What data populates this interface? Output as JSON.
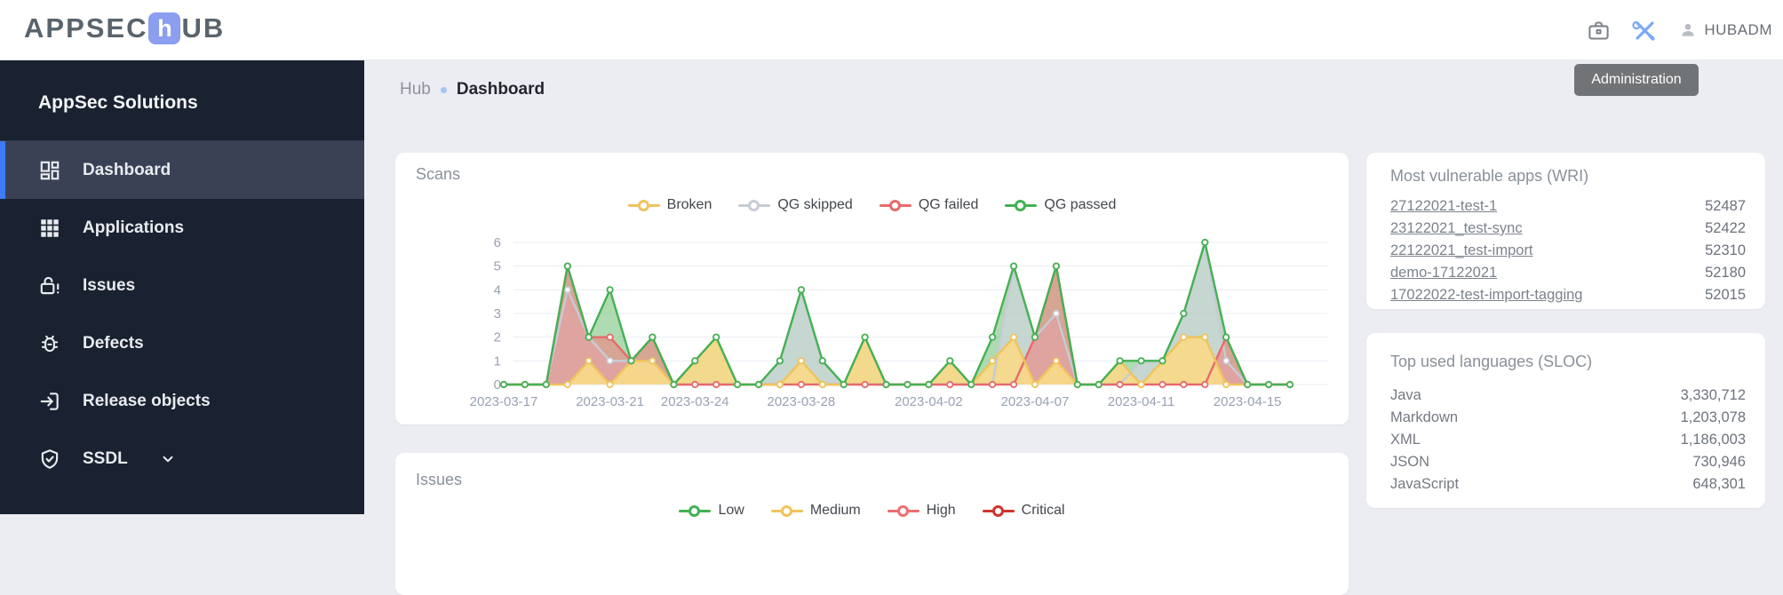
{
  "header": {
    "logo": {
      "prefix": "APPSEC",
      "accent_letter": "h",
      "suffix": "UB",
      "accent_color": "#8c9ef0",
      "text_color": "#5a646d"
    },
    "username": "HUBADM",
    "icons": {
      "briefcase": "briefcase-icon",
      "tools": "tools-icon",
      "user": "user-icon"
    },
    "tools_icon_color": "#7aa9f5"
  },
  "tooltip": {
    "text": "Administration",
    "bg": "#717476"
  },
  "sidebar": {
    "title": "AppSec Solutions",
    "bg": "#1a2130",
    "active_bg": "#3a4154",
    "accent": "#3d7bf7",
    "items": [
      {
        "label": "Dashboard",
        "icon": "dashboard-icon",
        "active": true
      },
      {
        "label": "Applications",
        "icon": "applications-icon",
        "active": false
      },
      {
        "label": "Issues",
        "icon": "unlock-alert-icon",
        "active": false
      },
      {
        "label": "Defects",
        "icon": "bug-icon",
        "active": false
      },
      {
        "label": "Release objects",
        "icon": "release-icon",
        "active": false
      },
      {
        "label": "SSDL",
        "icon": "shield-check-icon",
        "active": false,
        "expandable": true
      }
    ]
  },
  "breadcrumb": {
    "parent": "Hub",
    "current": "Dashboard",
    "dot_color": "#a5c4f2"
  },
  "vulnerable_apps": {
    "title": "Most vulnerable apps (WRI)",
    "rows": [
      {
        "name": "27122021-test-1",
        "value": "52487"
      },
      {
        "name": "23122021_test-sync",
        "value": "52422"
      },
      {
        "name": "22122021_test-import",
        "value": "52310"
      },
      {
        "name": "demo-17122021",
        "value": "52180"
      },
      {
        "name": "17022022-test-import-tagging",
        "value": "52015"
      }
    ]
  },
  "languages": {
    "title": "Top used languages (SLOC)",
    "rows": [
      {
        "name": "Java",
        "value": "3,330,712"
      },
      {
        "name": "Markdown",
        "value": "1,203,078"
      },
      {
        "name": "XML",
        "value": "1,186,003"
      },
      {
        "name": "JSON",
        "value": "730,946"
      },
      {
        "name": "JavaScript",
        "value": "648,301"
      }
    ]
  },
  "chart_data": {
    "type": "area",
    "title": "Scans",
    "xlabel": "",
    "ylabel": "",
    "ylim": [
      0,
      6
    ],
    "y_ticks": [
      0,
      1,
      2,
      3,
      4,
      5,
      6
    ],
    "grid_on": true,
    "grid_color": "#e9edf3",
    "axis_color": "#99a1b3",
    "legend_position": "top",
    "x_labels": [
      "2023-03-17",
      "2023-03-21",
      "2023-03-24",
      "2023-03-28",
      "2023-04-02",
      "2023-04-07",
      "2023-04-11",
      "2023-04-15"
    ],
    "x_label_indices": [
      0,
      5,
      9,
      14,
      20,
      25,
      30,
      35
    ],
    "series": [
      {
        "name": "Broken",
        "color": "#f0c35c",
        "fill": "rgba(247,217,138,0.95)",
        "values": [
          0,
          0,
          0,
          0,
          1,
          0,
          1,
          1,
          0,
          1,
          2,
          0,
          0,
          0,
          1,
          0,
          0,
          2,
          0,
          0,
          0,
          1,
          0,
          1,
          2,
          0,
          1,
          0,
          0,
          1,
          0,
          1,
          2,
          2,
          0,
          0,
          0,
          0
        ]
      },
      {
        "name": "QG skipped",
        "color": "#c6ccd4",
        "fill": "rgba(206,212,219,0.75)",
        "values": [
          0,
          0,
          0,
          4,
          2,
          1,
          1,
          1,
          0,
          0,
          0,
          0,
          0,
          1,
          4,
          1,
          0,
          0,
          0,
          0,
          0,
          0,
          0,
          0,
          5,
          2,
          3,
          0,
          0,
          0,
          1,
          1,
          3,
          6,
          1,
          0,
          0,
          0
        ]
      },
      {
        "name": "QG failed",
        "color": "#e86a6a",
        "fill": "rgba(240,128,128,0.6)",
        "values": [
          0,
          0,
          0,
          5,
          2,
          2,
          1,
          2,
          0,
          0,
          0,
          0,
          0,
          0,
          0,
          0,
          0,
          0,
          0,
          0,
          0,
          0,
          0,
          0,
          0,
          2,
          5,
          0,
          0,
          0,
          0,
          0,
          0,
          0,
          2,
          0,
          0,
          0
        ]
      },
      {
        "name": "QG passed",
        "color": "#45b054",
        "fill": "rgba(120,195,125,0.6)",
        "values": [
          0,
          0,
          0,
          5,
          2,
          4,
          1,
          2,
          0,
          1,
          2,
          0,
          0,
          1,
          4,
          1,
          0,
          2,
          0,
          0,
          0,
          1,
          0,
          2,
          5,
          2,
          5,
          0,
          0,
          1,
          1,
          1,
          3,
          6,
          2,
          0,
          0,
          0
        ]
      }
    ]
  },
  "issues_chart": {
    "type": "line",
    "title": "Issues",
    "legend_position": "top",
    "legend": [
      {
        "name": "Low",
        "color": "#45b054"
      },
      {
        "name": "Medium",
        "color": "#f0c35c"
      },
      {
        "name": "High",
        "color": "#ed6e6e"
      },
      {
        "name": "Critical",
        "color": "#d0342e"
      }
    ]
  }
}
